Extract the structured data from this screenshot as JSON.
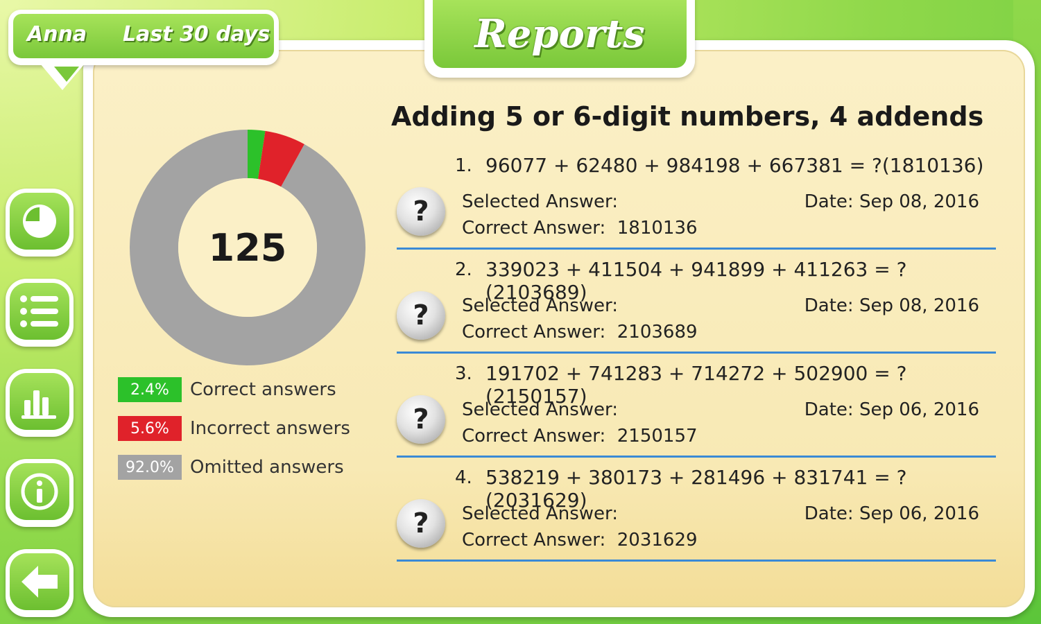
{
  "header": {
    "user_name": "Anna",
    "range": "Last 30 days",
    "title": "Reports"
  },
  "nav": [
    {
      "icon": "pie-chart-icon"
    },
    {
      "icon": "list-icon"
    },
    {
      "icon": "bar-chart-icon"
    },
    {
      "icon": "info-icon"
    },
    {
      "icon": "back-arrow-icon"
    }
  ],
  "summary": {
    "total": "125",
    "segments": [
      {
        "label": "Correct answers",
        "percent_text": "2.4%",
        "value": 2.4,
        "color": "#2cc12a"
      },
      {
        "label": "Incorrect answers",
        "percent_text": "5.6%",
        "value": 5.6,
        "color": "#e0222a"
      },
      {
        "label": "Omitted answers",
        "percent_text": "92.0%",
        "value": 92.0,
        "color": "#a3a3a3"
      }
    ]
  },
  "section_title": "Adding 5 or 6-digit numbers, 4 addends",
  "questions": [
    {
      "number": "1.",
      "expression": "96077 + 62480 + 984198 + 667381 = ?(1810136)",
      "selected": "Selected Answer:",
      "date": "Date: Sep 08, 2016",
      "correct": "Correct Answer:  1810136"
    },
    {
      "number": "2.",
      "expression": "339023 + 411504 + 941899 + 411263 = ?(2103689)",
      "selected": "Selected Answer:",
      "date": "Date: Sep 08, 2016",
      "correct": "Correct Answer:  2103689"
    },
    {
      "number": "3.",
      "expression": "191702 + 741283 + 714272 + 502900 = ?(2150157)",
      "selected": "Selected Answer:",
      "date": "Date: Sep 06, 2016",
      "correct": "Correct Answer:  2150157"
    },
    {
      "number": "4.",
      "expression": "538219 + 380173 + 281496 + 831741 = ?(2031629)",
      "selected": "Selected Answer:",
      "date": "Date: Sep 06, 2016",
      "correct": "Correct Answer:  2031629"
    }
  ],
  "question_icon": "?"
}
